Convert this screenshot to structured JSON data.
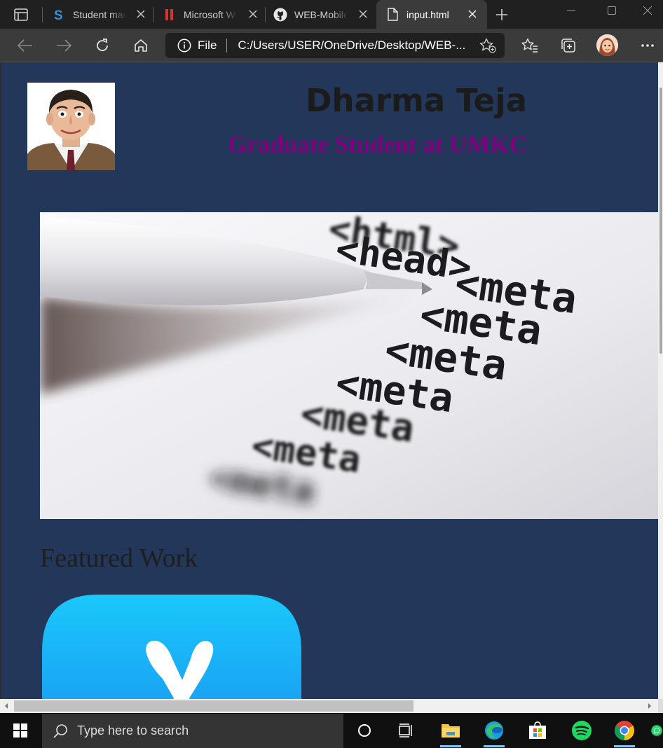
{
  "browser": {
    "tabs": [
      {
        "title": "Student management",
        "favicon": "s-logo-icon",
        "active": false
      },
      {
        "title": "Microsoft Word",
        "favicon": "red-bars-icon",
        "active": false
      },
      {
        "title": "WEB-Mobile",
        "favicon": "github-icon",
        "active": false
      },
      {
        "title": "input.html",
        "favicon": "document-icon",
        "active": true
      }
    ],
    "address": {
      "scheme_label": "File",
      "url": "C:/Users/USER/OneDrive/Desktop/WEB-..."
    }
  },
  "page": {
    "name": "Dharma Teja",
    "role": "Graduate Student at UMKC",
    "featured_title": "Featured Work",
    "colors": {
      "background": "#22375a",
      "name": "#1b1b1b",
      "role": "#800080",
      "featured": "#1e1e1e"
    },
    "hero_code_lines": [
      "<html>",
      "<head>",
      "<meta",
      "<meta",
      "<meta",
      "<meta",
      "<meta",
      "<meta",
      "<meta"
    ]
  },
  "taskbar": {
    "search_placeholder": "Type here to search",
    "icons": [
      "cortana-icon",
      "task-view-icon",
      "file-explorer-icon",
      "edge-icon",
      "store-icon",
      "spotify-icon",
      "chrome-icon"
    ]
  }
}
